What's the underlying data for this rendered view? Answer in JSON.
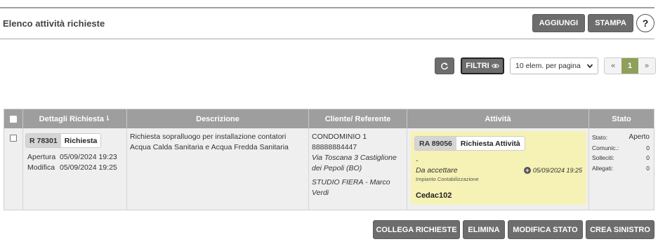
{
  "header": {
    "title": "Elenco attività richieste",
    "add_label": "AGGIUNGI",
    "print_label": "STAMPA",
    "help_label": "?"
  },
  "toolbar": {
    "filters_label": "FILTRI",
    "per_page": "10 elem. per pagina",
    "pager": {
      "first": "«",
      "current": "1",
      "last": "»"
    }
  },
  "table": {
    "columns": [
      "Dettagli Richiesta",
      "Descrizione",
      "Cliente/ Referente",
      "Attività",
      "Stato"
    ],
    "sort_mark": "⇂",
    "rows": [
      {
        "request_code": "R 78301",
        "request_type": "Richiesta",
        "opening_label": "Apertura",
        "opening_date": "05/09/2024 19:23",
        "modify_label": "Modifica",
        "modify_date": "05/09/2024 19:25",
        "description": "Richiesta sopralluogo per installazione contatori Acqua Calda Sanitaria e Acqua Fredda Sanitaria",
        "client_name": "CONDOMINIO 1",
        "client_phone": "88888884447",
        "client_address": "Via Toscana 3 Castiglione dei Pepoli (BO)",
        "referent": "STUDIO FIERA - Marco Verdi",
        "activity": {
          "code": "RA 89056",
          "type": "Richiesta Attività",
          "dash": "-",
          "state": "Da accettare",
          "subtype": "Impianto Contabilizzazione",
          "date": "05/09/2024 19:25",
          "user": "Cedac102"
        },
        "status": {
          "state_label": "Stato:",
          "state_value": "Aperto",
          "comms_label": "Comunic.:",
          "comms_value": "0",
          "reminders_label": "Solleciti:",
          "reminders_value": "0",
          "attachments_label": "Allegati:",
          "attachments_value": "0"
        }
      }
    ]
  },
  "footer": {
    "link_label": "COLLEGA RICHIESTE",
    "delete_label": "ELIMINA",
    "change_state_label": "MODIFICA STATO",
    "create_claim_label": "CREA SINISTRO"
  },
  "colors": {
    "button_bg": "#6d6d6d",
    "header_bg": "#9e9e9e",
    "activity_card_bg": "#f6f2b5",
    "pager_active": "#8fa05a"
  },
  "icons": [
    "refresh-icon",
    "eye-icon",
    "chevron-down-icon",
    "plus-circle-icon",
    "checkbox-icon"
  ]
}
